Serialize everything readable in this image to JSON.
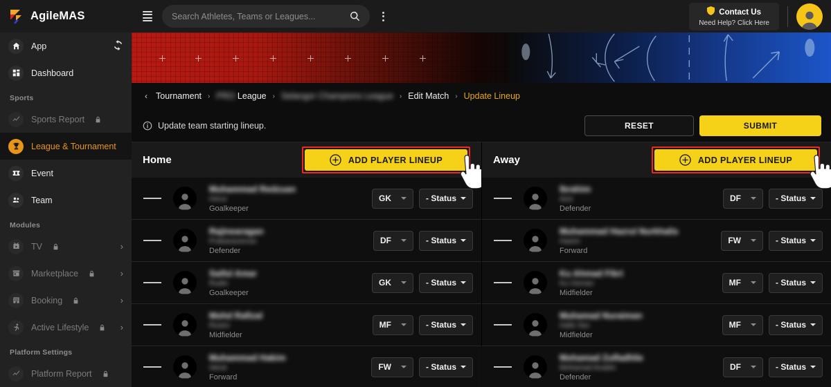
{
  "brand": {
    "name": "AgileMAS",
    "logo_icon": "agilemas-logo"
  },
  "sidebar": {
    "primary": [
      {
        "label": "App",
        "icon": "home-icon",
        "trailing": "refresh-icon",
        "state": "normal"
      },
      {
        "label": "Dashboard",
        "icon": "grid-icon",
        "state": "normal"
      }
    ],
    "sections": [
      {
        "title": "Sports",
        "items": [
          {
            "label": "Sports Report",
            "icon": "trend-icon",
            "locked": true,
            "state": "dim"
          },
          {
            "label": "League & Tournament",
            "icon": "trophy-icon",
            "state": "active"
          },
          {
            "label": "Event",
            "icon": "ticket-icon",
            "state": "normal"
          },
          {
            "label": "Team",
            "icon": "people-icon",
            "state": "normal"
          }
        ]
      },
      {
        "title": "Modules",
        "items": [
          {
            "label": "TV",
            "icon": "tv-icon",
            "locked": true,
            "state": "dim",
            "chevron": true
          },
          {
            "label": "Marketplace",
            "icon": "store-icon",
            "locked": true,
            "state": "dim",
            "chevron": true
          },
          {
            "label": "Booking",
            "icon": "building-icon",
            "locked": true,
            "state": "dim",
            "chevron": true
          },
          {
            "label": "Active Lifestyle",
            "icon": "runner-icon",
            "locked": true,
            "state": "dim",
            "chevron": true
          }
        ]
      },
      {
        "title": "Platform Settings",
        "items": [
          {
            "label": "Platform Report",
            "icon": "trend-icon",
            "locked": true,
            "state": "dim"
          }
        ]
      }
    ]
  },
  "topbar": {
    "menu_icon": "hamburger-icon",
    "search": {
      "placeholder": "Search Athletes, Teams or Leagues...",
      "value": "",
      "icon": "search-icon"
    },
    "kebab_icon": "more-vertical-icon",
    "contact": {
      "title": "Contact Us",
      "subtitle": "Need Help? Click Here",
      "icon": "shield-icon"
    },
    "avatar_icon": "user-avatar"
  },
  "breadcrumb": {
    "back_icon": "chevron-left-icon",
    "separator": "›",
    "items": [
      {
        "label": "Tournament",
        "active": false,
        "redacted": false
      },
      {
        "label": "PRO League",
        "active": false,
        "redacted": "partial"
      },
      {
        "label": "Selangor Champions League",
        "active": false,
        "redacted": true
      },
      {
        "label": "Edit Match",
        "active": false,
        "redacted": false
      },
      {
        "label": "Update Lineup",
        "active": true,
        "redacted": false
      }
    ]
  },
  "info": {
    "icon": "info-icon",
    "text": "Update team starting lineup.",
    "reset_label": "RESET",
    "submit_label": "SUBMIT"
  },
  "colors": {
    "accent_yellow": "#f5d118",
    "accent_orange": "#e8951a",
    "highlight_red": "#ee2b1d",
    "sidebar_bg": "#222222",
    "page_bg": "#0d0d0d"
  },
  "columns": [
    {
      "title": "Home",
      "add_label": "ADD PLAYER LINEUP",
      "add_icon": "plus-circle-icon",
      "highlighted": true,
      "cursor": true,
      "players": [
        {
          "name": "Muhammad Redzuan",
          "alias": "Herul",
          "position": "Goalkeeper",
          "pos_code": "GK",
          "status": "- Status"
        },
        {
          "name": "Rajinearagan",
          "alias": "Prakaraveeran",
          "position": "Defender",
          "pos_code": "DF",
          "status": "- Status"
        },
        {
          "name": "Saiful Amar",
          "alias": "Rudin",
          "position": "Goalkeeper",
          "pos_code": "GK",
          "status": "- Status"
        },
        {
          "name": "Mohd Rafizal",
          "alias": "Rosim",
          "position": "Midfielder",
          "pos_code": "MF",
          "status": "- Status"
        },
        {
          "name": "Muhammad Hakim",
          "alias": "Iskral",
          "position": "Forward",
          "pos_code": "FW",
          "status": "- Status"
        }
      ]
    },
    {
      "title": "Away",
      "add_label": "ADD PLAYER LINEUP",
      "add_icon": "plus-circle-icon",
      "highlighted": true,
      "cursor": true,
      "players": [
        {
          "name": "Ibrahim",
          "alias": "Aziz",
          "position": "Defender",
          "pos_code": "DF",
          "status": "- Status"
        },
        {
          "name": "Muhammad Hazrul Nurkhalis",
          "alias": "Hazim",
          "position": "Forward",
          "pos_code": "FW",
          "status": "- Status"
        },
        {
          "name": "Ku Ahmad Fikri",
          "alias": "Ku Osman",
          "position": "Midfielder",
          "pos_code": "MF",
          "status": "- Status"
        },
        {
          "name": "Muhamad Nuraiman",
          "alias": "Hafiz Nor",
          "position": "Midfielder",
          "pos_code": "MF",
          "status": "- Status"
        },
        {
          "name": "Mohamad Zulfadhlie",
          "alias": "Mohamad Anabin",
          "position": "Defender",
          "pos_code": "DF",
          "status": "- Status"
        }
      ]
    }
  ]
}
